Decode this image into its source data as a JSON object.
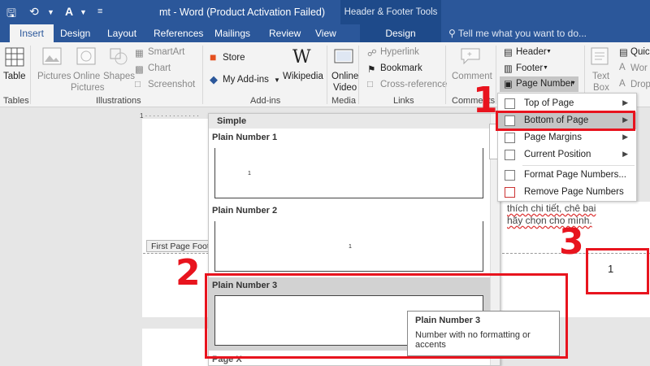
{
  "window": {
    "title": "mt - Word (Product Activation Failed)",
    "context_tools": "Header & Footer Tools"
  },
  "tabs": [
    {
      "label": "Insert",
      "active": true
    },
    {
      "label": "Design"
    },
    {
      "label": "Layout"
    },
    {
      "label": "References"
    },
    {
      "label": "Mailings"
    },
    {
      "label": "Review"
    },
    {
      "label": "View"
    },
    {
      "label": "Design",
      "context": true
    }
  ],
  "tell_me": "Tell me what you want to do...",
  "ribbon": {
    "table": {
      "label": "Table",
      "group": "Tables"
    },
    "illustrations": {
      "group": "Illustrations",
      "pictures": "Pictures",
      "online_pictures_1": "Online",
      "online_pictures_2": "Pictures",
      "shapes": "Shapes",
      "smartart": "SmartArt",
      "chart": "Chart",
      "screenshot": "Screenshot"
    },
    "addins": {
      "group": "Add-ins",
      "store": "Store",
      "my_addins": "My Add-ins",
      "wikipedia": "Wikipedia"
    },
    "media": {
      "group": "Media",
      "online_video_1": "Online",
      "online_video_2": "Video"
    },
    "links": {
      "group": "Links",
      "hyperlink": "Hyperlink",
      "bookmark": "Bookmark",
      "cross_reference": "Cross-reference"
    },
    "comments": {
      "group": "Comments",
      "comment": "Comment"
    },
    "header_footer": {
      "header": "Header",
      "footer": "Footer",
      "page_number": "Page Number"
    },
    "text": {
      "text_box_1": "Text",
      "text_box_2": "Box",
      "quick": "Quic",
      "wordart": "Wor",
      "dropcap": "Drop"
    }
  },
  "page_number_menu": [
    {
      "label": "Top of Page",
      "arrow": true
    },
    {
      "label": "Bottom of Page",
      "arrow": true,
      "highlighted": true
    },
    {
      "label": "Page Margins",
      "arrow": true
    },
    {
      "label": "Current Position",
      "arrow": true
    },
    {
      "label": "Format Page Numbers...",
      "arrow": false
    },
    {
      "label": "Remove Page Numbers",
      "arrow": false
    }
  ],
  "gallery": {
    "header": "Simple",
    "items": [
      {
        "label": "Plain Number 1",
        "number": "1"
      },
      {
        "label": "Plain Number 2",
        "number": "1"
      },
      {
        "label": "Plain Number 3",
        "number": ""
      }
    ],
    "cut_label": "Page X"
  },
  "tooltip": {
    "title": "Plain Number 3",
    "desc_1": "Number with no formatting or",
    "desc_2": "accents"
  },
  "document": {
    "footer_tag": "First Page Foote",
    "text_line_1": "thích chi tiết, chê bai",
    "text_line_2": "hãy chọn cho mình.",
    "page_number_preview": "1"
  },
  "annotations": {
    "step1": "1",
    "step2": "2",
    "step3": "3"
  },
  "colors": {
    "accent": "#2b579a",
    "annotation_red": "#e8141e"
  }
}
